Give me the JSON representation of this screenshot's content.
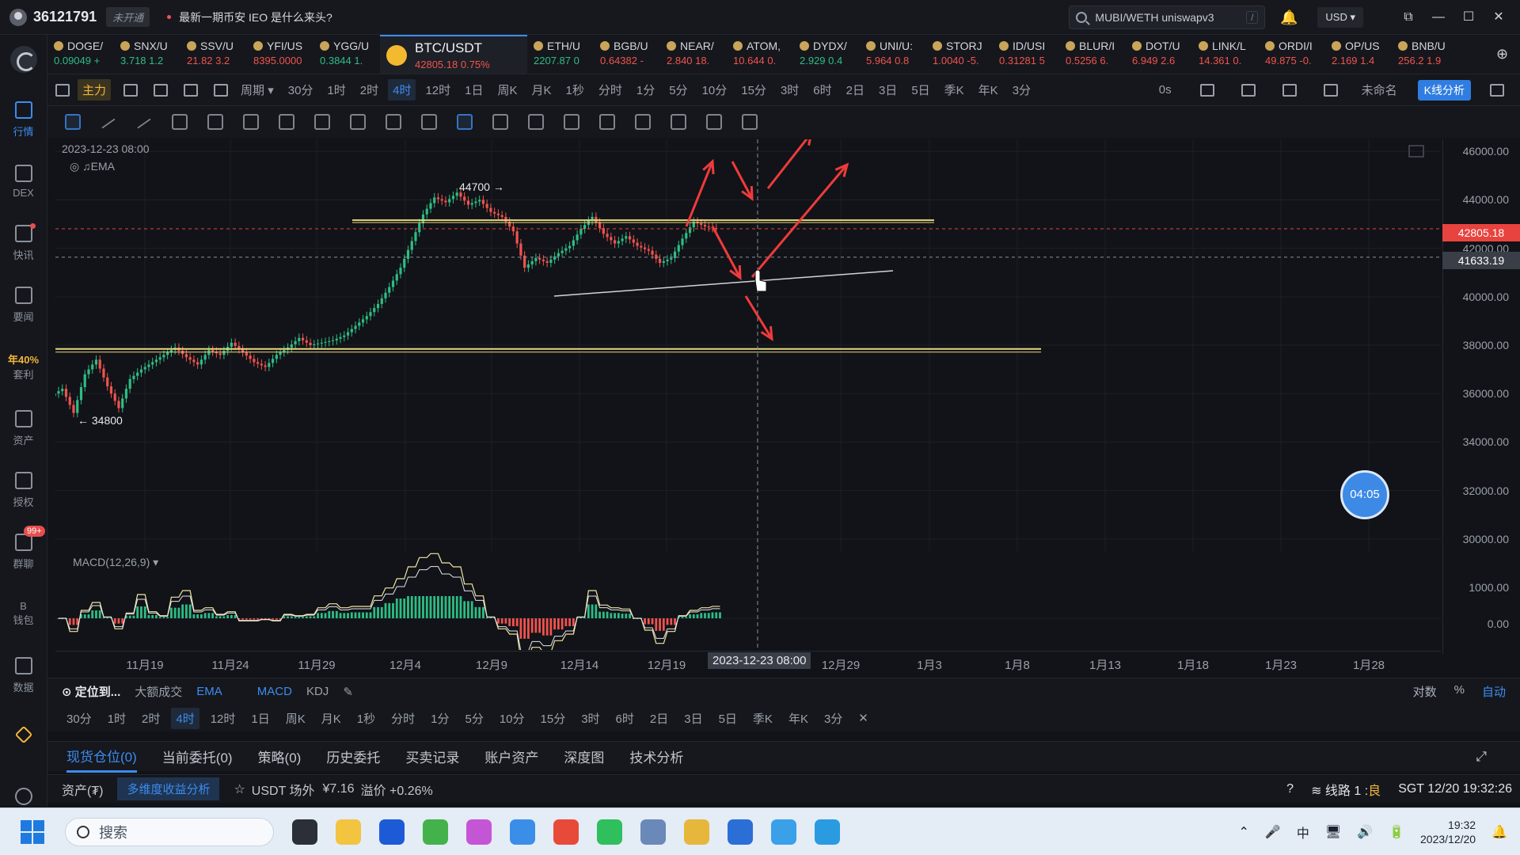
{
  "titlebar": {
    "account_id": "36121791",
    "vip_label": "未开通",
    "news": "最新一期币安 IEO 是什么来头?",
    "search_value": "MUBI/WETH uniswapv3",
    "search_shortcut": "/",
    "currency": "USD"
  },
  "sidebar": [
    {
      "label": "行情",
      "icon": "market-icon",
      "active": true
    },
    {
      "label": "DEX",
      "icon": "dex-icon"
    },
    {
      "label": "快讯",
      "icon": "flash-news-icon",
      "dot": true
    },
    {
      "label": "要闻",
      "icon": "news-icon"
    },
    {
      "label": "套利",
      "icon": "arbitrage-icon",
      "promo": "年40%"
    },
    {
      "label": "资产",
      "icon": "assets-icon"
    },
    {
      "label": "授权",
      "icon": "authorization-icon"
    },
    {
      "label": "群聊",
      "icon": "group-chat-icon",
      "badge": "99+"
    },
    {
      "label": "钱包",
      "icon": "wallet-icon",
      "prefix": "B"
    },
    {
      "label": "数据",
      "icon": "data-icon"
    }
  ],
  "tickers": [
    {
      "name": "DOGE/",
      "price": "0.09049",
      "chg": "+",
      "dir": "up"
    },
    {
      "name": "SNX/U",
      "price": "3.718",
      "chg": "1.2",
      "dir": "up"
    },
    {
      "name": "SSV/U",
      "price": "21.82",
      "chg": "3.2",
      "dir": "dn"
    },
    {
      "name": "YFI/US",
      "price": "8395.0000",
      "chg": "",
      "dir": "dn"
    },
    {
      "name": "YGG/U",
      "price": "0.3844",
      "chg": "1.",
      "dir": "up"
    },
    {
      "name": "BTC/USDT",
      "price": "42805.18",
      "chg": "0.75%",
      "dir": "dn",
      "active": true
    },
    {
      "name": "ETH/U",
      "price": "2207.87",
      "chg": "0",
      "dir": "up"
    },
    {
      "name": "BGB/U",
      "price": "0.64382",
      "chg": "-",
      "dir": "dn"
    },
    {
      "name": "NEAR/",
      "price": "2.840",
      "chg": "18.",
      "dir": "dn"
    },
    {
      "name": "ATOM,",
      "price": "10.644",
      "chg": "0.",
      "dir": "dn"
    },
    {
      "name": "DYDX/",
      "price": "2.929",
      "chg": "0.4",
      "dir": "up"
    },
    {
      "name": "UNI/U:",
      "price": "5.964",
      "chg": "0.8",
      "dir": "dn"
    },
    {
      "name": "STORJ",
      "price": "1.0040",
      "chg": "-5.",
      "dir": "dn"
    },
    {
      "name": "ID/USI",
      "price": "0.31281",
      "chg": "5",
      "dir": "dn"
    },
    {
      "name": "BLUR/I",
      "price": "0.5256",
      "chg": "6.",
      "dir": "dn"
    },
    {
      "name": "DOT/U",
      "price": "6.949",
      "chg": "2.6",
      "dir": "dn"
    },
    {
      "name": "LINK/L",
      "price": "14.361",
      "chg": "0.",
      "dir": "dn"
    },
    {
      "name": "ORDI/I",
      "price": "49.875",
      "chg": "-0.",
      "dir": "dn"
    },
    {
      "name": "OP/US",
      "price": "2.169",
      "chg": "1.4",
      "dir": "dn"
    },
    {
      "name": "BNB/U",
      "price": "256.2",
      "chg": "1.9",
      "dir": "dn"
    }
  ],
  "periods": {
    "main_label": "主力",
    "cycle_label": "周期",
    "items": [
      "30分",
      "1时",
      "2时",
      "4时",
      "12时",
      "1日",
      "周K",
      "月K",
      "1秒",
      "分时",
      "1分",
      "5分",
      "10分",
      "15分",
      "3时",
      "6时",
      "2日",
      "3日",
      "5日",
      "季K",
      "年K",
      "3分"
    ],
    "active": "4时",
    "right_label": "0s",
    "layout_name": "未命名",
    "kline_button": "K线分析"
  },
  "chart": {
    "date": "2023-12-23 08:00",
    "ema_label": "EMA",
    "high_label": "44700",
    "low_label": "34800",
    "countdown": "04:05",
    "current_price": "42805.18",
    "cursor_price": "41633.19",
    "macd_label": "MACD(12,26,9)",
    "x_selected": "2023-12-23 08:00"
  },
  "chart_data": {
    "type": "candlestick",
    "symbol": "BTC/USDT",
    "interval": "4时",
    "y_ticks": [
      "46000.00",
      "44000.00",
      "42000.00",
      "40000.00",
      "38000.00",
      "36000.00",
      "34000.00",
      "32000.00",
      "30000.00"
    ],
    "macd_ticks": [
      "1000.00",
      "0.00"
    ],
    "x_ticks": [
      "11月19",
      "11月24",
      "11月29",
      "12月4",
      "12月9",
      "12月14",
      "12月19",
      "12月29",
      "1月3",
      "1月8",
      "1月13",
      "1月18",
      "1月23",
      "1月28"
    ],
    "ylim": [
      29500,
      46500
    ],
    "close_series": [
      36200,
      35200,
      36800,
      37400,
      36300,
      35400,
      36600,
      37000,
      37300,
      37600,
      37900,
      37500,
      37200,
      37800,
      37600,
      38100,
      37700,
      37300,
      37100,
      37600,
      37900,
      38300,
      38000,
      38100,
      38200,
      38400,
      38800,
      39200,
      39700,
      40400,
      41200,
      42300,
      43400,
      44100,
      43900,
      44300,
      43800,
      44000,
      43500,
      43300,
      42700,
      41200,
      41600,
      41400,
      41800,
      42100,
      42800,
      43300,
      42600,
      42200,
      42500,
      42100,
      41900,
      41400,
      41600,
      42400,
      43100,
      42900,
      42805
    ],
    "resistance": 42800,
    "support": 38500,
    "high": 44700,
    "low": 34800,
    "current": 42805.18,
    "cursor": 41633.19
  },
  "indicators": {
    "locate": "定位到...",
    "items": [
      "大额成交",
      "EMA",
      "MACD",
      "KDJ"
    ],
    "right": [
      "对数",
      "%",
      "自动"
    ]
  },
  "periods2": [
    "30分",
    "1时",
    "2时",
    "4时",
    "12时",
    "1日",
    "周K",
    "月K",
    "1秒",
    "分时",
    "1分",
    "5分",
    "10分",
    "15分",
    "3时",
    "6时",
    "2日",
    "3日",
    "5日",
    "季K",
    "年K",
    "3分"
  ],
  "bottom_tabs": [
    "现货仓位(0)",
    "当前委托(0)",
    "策略(0)",
    "历史委托",
    "买卖记录",
    "账户资产",
    "深度图",
    "技术分析"
  ],
  "assetbar": {
    "assets": "资产(₮)",
    "analysis_btn": "多维度收益分析",
    "usdt_label": "USDT 场外",
    "usdt_price": "¥7.16",
    "premium": "溢价 +0.26%",
    "line": "线路 1 :",
    "line_status": "良",
    "time": "SGT 12/20 19:32:26"
  },
  "taskbar": {
    "search": "搜索",
    "time": "19:32",
    "date": "2023/12/20",
    "ime": "中"
  }
}
